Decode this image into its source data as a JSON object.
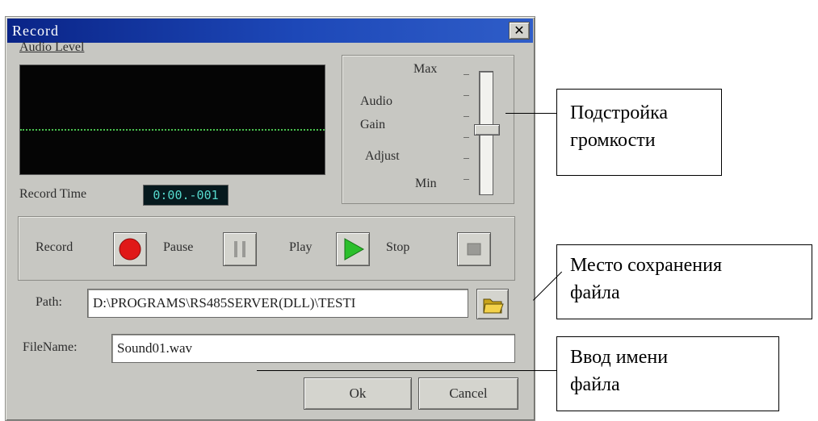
{
  "dialog": {
    "title": "Record",
    "close_glyph": "✕",
    "audio_level_label": "Audio Level",
    "record_time_label": "Record Time",
    "record_time_value": "0:00.-001",
    "gain": {
      "max_label": "Max",
      "label_line1": "Audio",
      "label_line2": "Gain",
      "label_line3": "Adjust",
      "min_label": "Min",
      "level": 0.5
    },
    "controls": {
      "record_label": "Record",
      "pause_label": "Pause",
      "play_label": "Play",
      "stop_label": "Stop"
    },
    "path_label": "Path:",
    "path_value": "D:\\PROGRAMS\\RS485SERVER(DLL)\\TESTI",
    "filename_label": "FileName:",
    "filename_value": "Sound01.wav",
    "ok_label": "Ok",
    "cancel_label": "Cancel",
    "colors": {
      "title_bar": "#0a2487",
      "scope_bg": "#050505",
      "trace": "#49c14e",
      "record_button": "#e01818",
      "play_button": "#2bbf2b"
    },
    "icons": [
      "close-icon",
      "record-icon",
      "pause-icon",
      "play-icon",
      "stop-icon",
      "folder-open-icon"
    ]
  },
  "annotations": {
    "volume": {
      "line1": "Подстройка",
      "line2": "громкости"
    },
    "save_location": {
      "line1": "Место сохранения",
      "line2": "файла"
    },
    "filename": {
      "line1": "Ввод имени",
      "line2": "файла"
    }
  }
}
